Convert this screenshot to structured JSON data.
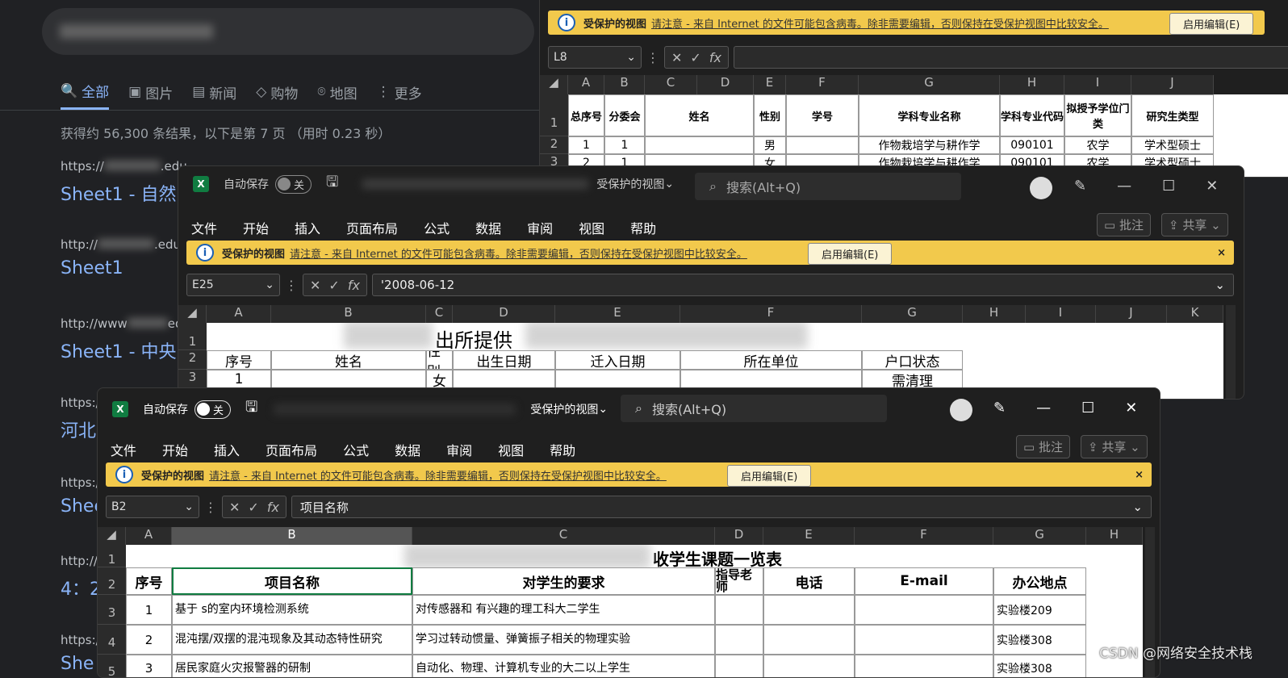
{
  "google": {
    "tabs": [
      "全部",
      "图片",
      "新闻",
      "购物",
      "地图",
      "更多"
    ],
    "stats": "获得约 56,300 条结果，以下是第 7 页 （用时 0.23 秒）",
    "results": [
      {
        "url": "https://",
        "url2": ".edu",
        "title": "Sheet1 - 自然"
      },
      {
        "url": "http://",
        "url2": ".edu.",
        "title": "Sheet1"
      },
      {
        "url": "http://www",
        "url2": "edu.",
        "title": "Sheet1 - 中央"
      },
      {
        "url": "https://",
        "url2": "",
        "title": "河北"
      },
      {
        "url": "https://",
        "url2": "",
        "title": "Shee"
      },
      {
        "url": "http://",
        "url2": "",
        "title": "4：2"
      },
      {
        "url": "https://",
        "url2": "",
        "title": "She"
      }
    ]
  },
  "protected": {
    "title": "受保护的视图",
    "message": "请注意 - 来自 Internet 的文件可能包含病毒。除非需要编辑，否则保持在受保护视图中比较安全。",
    "enable": "启用编辑(E)",
    "close": "×"
  },
  "excel_common": {
    "autosave": "自动保存",
    "off": "关",
    "view_mode": "受保护的视图",
    "search": "搜索(Alt+Q)",
    "menu": [
      "文件",
      "开始",
      "插入",
      "页面布局",
      "公式",
      "数据",
      "审阅",
      "视图",
      "帮助"
    ],
    "comment": "批注",
    "share": "共享"
  },
  "win1": {
    "namebox": "L8",
    "cols": [
      "A",
      "B",
      "C",
      "D",
      "E",
      "F",
      "G",
      "H",
      "I",
      "J"
    ],
    "rows": [
      "1",
      "2",
      "3"
    ],
    "headers": [
      "总序号",
      "分委会",
      "姓名",
      "性别",
      "学号",
      "学科专业名称",
      "学科专业代码",
      "拟授予学位门类",
      "研究生类型"
    ],
    "row2": [
      "1",
      "1",
      "",
      "男",
      "",
      "作物栽培学与耕作学",
      "090101",
      "农学",
      "学术型硕士"
    ],
    "row3": [
      "2",
      "1",
      "",
      "女",
      "",
      "作物栽培学与耕作学",
      "090101",
      "农学",
      "学术型硕士"
    ]
  },
  "win2": {
    "namebox": "E25",
    "formula": "'2008-06-12",
    "cols": [
      "A",
      "B",
      "C",
      "D",
      "E",
      "F",
      "G",
      "H",
      "I",
      "J",
      "K"
    ],
    "rows": [
      "1",
      "2",
      "3"
    ],
    "title_part": "出所提供",
    "headers": [
      "序号",
      "姓名",
      "性别",
      "出生日期",
      "迁入日期",
      "所在单位",
      "户口状态"
    ],
    "row3": [
      "1",
      "",
      "女",
      "",
      "",
      "",
      "需清理"
    ]
  },
  "win3": {
    "namebox": "B2",
    "formula": "项目名称",
    "cols": [
      "A",
      "B",
      "C",
      "D",
      "E",
      "F",
      "G",
      "H"
    ],
    "rows": [
      "1",
      "2",
      "3",
      "4",
      "5"
    ],
    "title_part": "收学生课题一览表",
    "headers": [
      "序号",
      "项目名称",
      "对学生的要求",
      "指导老师",
      "电话",
      "E-mail",
      "办公地点"
    ],
    "rows_data": [
      {
        "n": "1",
        "name": "基于        s的室内环境检测系统",
        "req": "对传感器和      有兴趣的理工科大二学生",
        "loc": "实验楼209"
      },
      {
        "n": "2",
        "name": "混沌摆/双摆的混沌现象及其动态特性研究",
        "req": "学习过转动惯量、弹簧振子相关的物理实验",
        "loc": "实验楼308"
      },
      {
        "n": "3",
        "name": "居民家庭火灾报警器的研制",
        "req": "自动化、物理、计算机专业的大二以上学生",
        "loc": "实验楼308"
      }
    ]
  },
  "watermark": "CSDN @网络安全技术栈"
}
